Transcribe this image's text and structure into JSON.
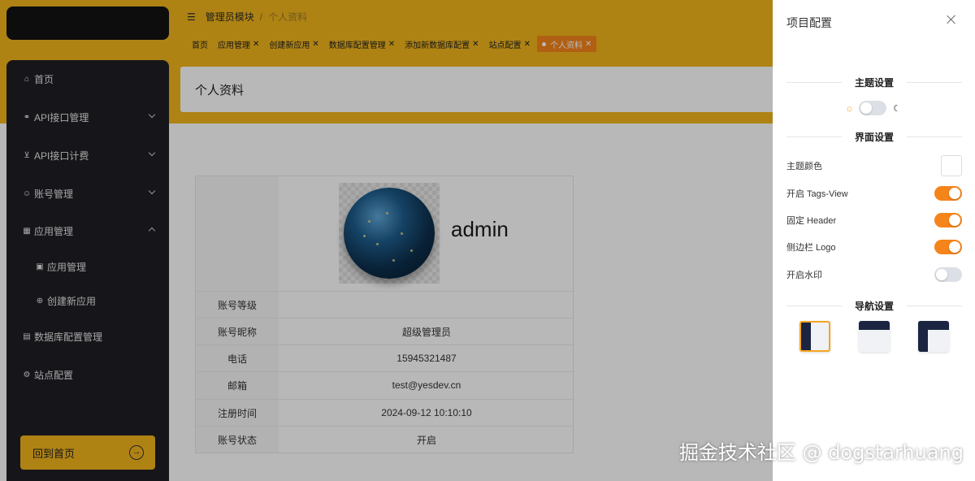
{
  "sidebar": {
    "items": [
      {
        "label": "首页",
        "icon": "home-icon"
      },
      {
        "label": "API接口管理",
        "icon": "link-icon"
      },
      {
        "label": "API接口计费",
        "icon": "cart-icon"
      },
      {
        "label": "账号管理",
        "icon": "user-icon"
      },
      {
        "label": "应用管理",
        "icon": "grid-icon"
      },
      {
        "label": "应用管理",
        "icon": "bag-icon"
      },
      {
        "label": "创建新应用",
        "icon": "plus-circle-icon"
      },
      {
        "label": "数据库配置管理",
        "icon": "database-icon"
      },
      {
        "label": "站点配置",
        "icon": "gear-icon"
      }
    ],
    "home_button": "回到首页"
  },
  "breadcrumb": {
    "parent": "管理员模块",
    "current": "个人资料"
  },
  "tags": [
    {
      "label": "首页",
      "closable": false
    },
    {
      "label": "应用管理",
      "closable": true
    },
    {
      "label": "创建新应用",
      "closable": true
    },
    {
      "label": "数据库配置管理",
      "closable": true
    },
    {
      "label": "添加新数据库配置",
      "closable": true
    },
    {
      "label": "站点配置",
      "closable": true
    },
    {
      "label": "个人资料",
      "closable": true,
      "active": true
    }
  ],
  "page": {
    "title": "个人资料",
    "username": "admin",
    "rows": [
      {
        "key": "账号等级",
        "value": ""
      },
      {
        "key": "账号昵称",
        "value": "超级管理员"
      },
      {
        "key": "电话",
        "value": "15945321487"
      },
      {
        "key": "邮箱",
        "value": "test@yesdev.cn"
      },
      {
        "key": "注册时间",
        "value": "2024-09-12 10:10:10"
      },
      {
        "key": "账号状态",
        "value": "开启"
      }
    ]
  },
  "drawer": {
    "title": "项目配置",
    "theme_section": "主题设置",
    "dark_mode": false,
    "ui_section": "界面设置",
    "theme_color_label": "主题颜色",
    "theme_color": "#f5841a",
    "toggles": [
      {
        "label": "开启 Tags-View",
        "on": true
      },
      {
        "label": "固定 Header",
        "on": true
      },
      {
        "label": "侧边栏 Logo",
        "on": true
      },
      {
        "label": "开启水印",
        "on": false
      }
    ],
    "nav_section": "导航设置",
    "nav_layouts": [
      "side-layout",
      "top-layout",
      "mixed-layout"
    ],
    "nav_selected": "side-layout"
  },
  "watermark": "掘金技术社区 @ dogstarhuang",
  "colors": {
    "accent": "#f5841a",
    "header_yellow": "#f2b61d",
    "sidebar_dark": "#1f1f24"
  }
}
